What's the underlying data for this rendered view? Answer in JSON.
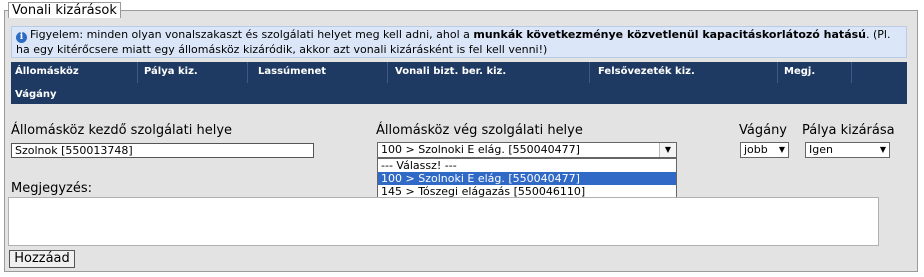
{
  "fieldset": {
    "legend": "Vonali kizárások"
  },
  "info": {
    "prefix": "Figyelem: minden olyan vonalszakaszt és szolgálati helyet meg kell adni, ahol a ",
    "bold": "munkák következménye közvetlenül kapacitáskorlátozó hatású",
    "suffix": ". (Pl. ha egy kitérőcsere miatt egy állomásköz kizáródik, akkor azt vonali kizárásként is fel kell venni!)"
  },
  "grid": {
    "headers": [
      "Állomásköz",
      "Pálya kiz.",
      "Lassúmenet",
      "Vonali bizt. ber. kiz.",
      "Felsővezeték kiz.",
      "Megj."
    ],
    "row2": "Vágány"
  },
  "form": {
    "start_label": "Állomásköz kezdő szolgálati helye",
    "start_value": "Szolnok [550013748]",
    "end_label": "Állomásköz vég szolgálati helye",
    "end_value": "100 > Szolnoki E elág. [550040477]",
    "end_options": [
      "--- Válassz! ---",
      "100 > Szolnoki E elág. [550040477]",
      "145 > Tószegi elágazás [550046110]"
    ],
    "track_label": "Vágány",
    "track_value": "jobb",
    "exclusion_label": "Pálya kizárása",
    "exclusion_value": "Igen",
    "note_label": "Megjegyzés:",
    "note_value": "",
    "add_button": "Hozzáad"
  }
}
